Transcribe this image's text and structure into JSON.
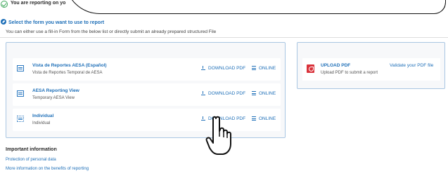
{
  "banner": {
    "text": "You are reporting on yo",
    "check_color": "#3aa657"
  },
  "select_section": {
    "title": "Select the form you want to use to report",
    "subtitle": "You can either use a fill-in Form from the below list or directly submit an already prepared structured File"
  },
  "forms": [
    {
      "name": "Vista de Reportes AESA (Español)",
      "description": "Vista de Reportes Temporal de AESA",
      "download_label": "DOWNLOAD PDF",
      "online_label": "ONLINE",
      "icon": "table-icon"
    },
    {
      "name": "AESA Reporting View",
      "description": "Temporary AESA View",
      "download_label": "DOWNLOAD PDF",
      "online_label": "ONLINE",
      "icon": "table-icon"
    },
    {
      "name": "Individual",
      "description": "Individual",
      "download_label": "DOWNLOAD PDF",
      "online_label": "ONLINE",
      "icon": "grid-icon"
    }
  ],
  "upload": {
    "title": "UPLOAD PDF",
    "description": "Upload PDF to submit a report",
    "validate_label": "Validate your PDF file",
    "icon_color": "#d9323a"
  },
  "info": {
    "title": "Important information",
    "links": [
      "Protection of personal data",
      "More information on the benefits of reporting"
    ]
  },
  "colors": {
    "accent": "#1e6fb8",
    "panel_border": "#a9c6e2"
  },
  "cursor": {
    "icon": "hand-pointer-icon"
  }
}
